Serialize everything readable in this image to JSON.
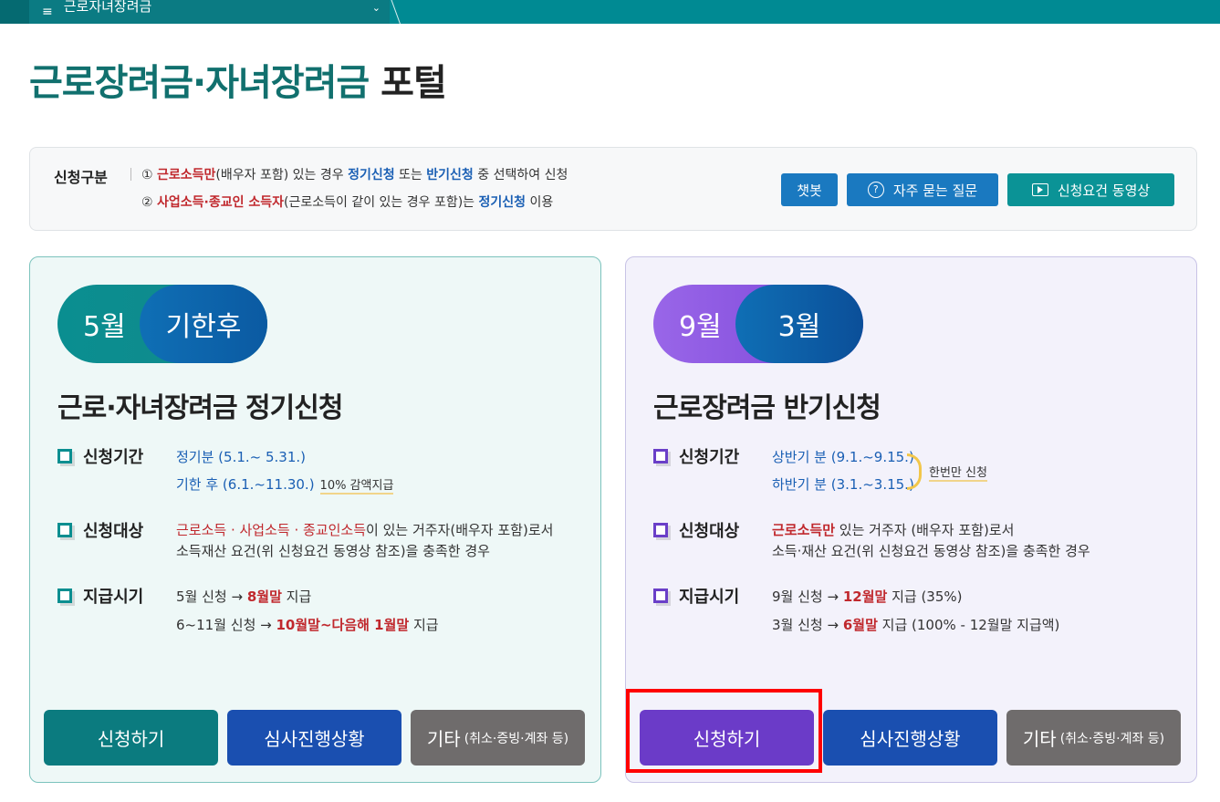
{
  "nav": {
    "menu_icon": "≡",
    "menu_label": "근로자녀장려금",
    "chevron": "⌄"
  },
  "page_title": {
    "part1": "근로장려금·자녀장려금",
    "part2": "포털"
  },
  "info": {
    "label": "신청구분",
    "line1": {
      "num": "①",
      "a": "근로소득만",
      "b": "(배우자 포함) 있는 경우 ",
      "c": "정기신청",
      "d": " 또는 ",
      "e": "반기신청",
      "f": " 중 선택하여 신청"
    },
    "line2": {
      "num": "②",
      "a": "사업소득·종교인 소득자",
      "b": "(근로소득이 같이 있는 경우 포함)는 ",
      "c": "정기신청",
      "d": " 이용"
    },
    "buttons": {
      "chatbot": "챗봇",
      "faq": "자주 묻는 질문",
      "video": "신청요건 동영상"
    }
  },
  "left_card": {
    "pill1": "5월",
    "pill2": "기한후",
    "title": "근로·자녀장려금 정기신청",
    "period_label": "신청기간",
    "period_1": "정기분 (5.1.~ 5.31.)",
    "period_2": "기한 후 (6.1.~11.30.)",
    "period_2_note": "10% 감액지급",
    "target_label": "신청대상",
    "target_red": "근로소득 · 사업소득 · 종교인소득",
    "target_1": "이 있는 거주자(배우자 포함)로서",
    "target_2": "소득재산 요건(위 신청요건 동영상 참조)을 충족한 경우",
    "pay_label": "지급시기",
    "pay_1a": "5월 신청 → ",
    "pay_1b": "8월말",
    "pay_1c": " 지급",
    "pay_2a": "6~11월 신청 → ",
    "pay_2b": "10월말~다음해 1월말",
    "pay_2c": " 지급",
    "btn_apply": "신청하기",
    "btn_status": "심사진행상황",
    "btn_etc": "기타",
    "btn_etc_small": "(취소·증빙·계좌 등)"
  },
  "right_card": {
    "pill1": "9월",
    "pill2": "3월",
    "title": "근로장려금 반기신청",
    "period_label": "신청기간",
    "period_1": "상반기 분 (9.1.~9.15.)",
    "period_2": "하반기 분 (3.1.~3.15.)",
    "period_note": "한번만 신청",
    "target_label": "신청대상",
    "target_red": "근로소득만",
    "target_1": " 있는 거주자 (배우자 포함)로서",
    "target_2": "소득·재산 요건(위 신청요건 동영상 참조)을 충족한 경우",
    "pay_label": "지급시기",
    "pay_1a": "9월 신청 → ",
    "pay_1b": "12월말",
    "pay_1c": " 지급 (35%)",
    "pay_2a": "3월 신청 → ",
    "pay_2b": "6월말",
    "pay_2c": " 지급 (100% - 12월말 지급액)",
    "btn_apply": "신청하기",
    "btn_status": "심사진행상황",
    "btn_etc": "기타",
    "btn_etc_small": "(취소·증빙·계좌 등)"
  }
}
